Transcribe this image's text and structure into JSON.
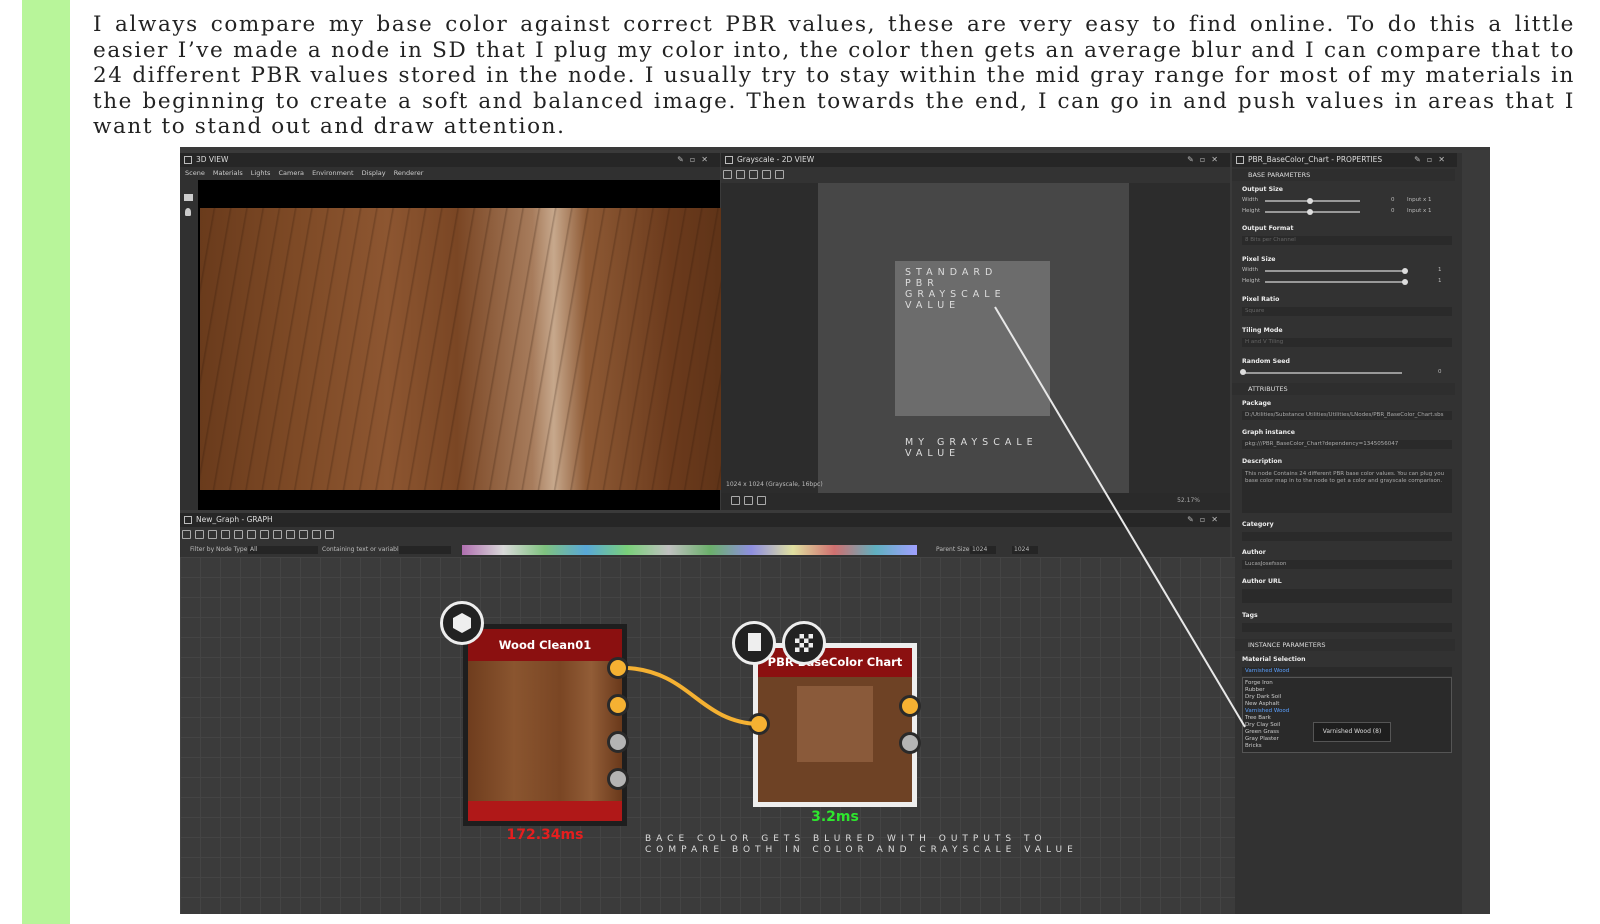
{
  "article": {
    "paragraph": "I always compare my base color against correct PBR values, these are very easy to find online. To do this a little easier I’ve made a node in SD that I plug my color into, the color then gets an average blur and I can compare that to 24 different PBR values stored in the node. I usually try to stay within the mid gray range for most of my materials in the beginning to create a soft and balanced image. Then towards the end, I can go in and push values in areas that I want to stand out and draw attention."
  },
  "view3d": {
    "title": "3D VIEW",
    "menu": [
      "Scene",
      "Materials",
      "Lights",
      "Camera",
      "Environment",
      "Display",
      "Renderer"
    ]
  },
  "view2d": {
    "title": "Grayscale - 2D VIEW",
    "annotation_top": "STANDARD PBR GRAYSCALE VALUE",
    "annotation_bottom": "MY GRAYSCALE VALUE",
    "image_info": "1024 x 1024 (Grayscale, 16bpc)",
    "zoom": "52.17%"
  },
  "graph": {
    "title": "New_Graph - GRAPH",
    "filter_label": "Filter by Node Type",
    "filter_value": "All",
    "containing_label": "Containing text or variable",
    "parent_size_label": "Parent Size:",
    "parent_size_w": "1024",
    "parent_size_h": "1024",
    "node1_title": "Wood Clean01",
    "node1_time": "172.34ms",
    "node2_title": "PBR BaseColor Chart",
    "node2_time": "3.2ms",
    "annotation": "BACE COLOR GETS BLURED WITH OUTPUTS TO COMPARE BOTH IN COLOR AND CRAYSCALE VALUE"
  },
  "properties": {
    "title": "PBR_BaseColor_Chart - PROPERTIES",
    "base_parameters": "BASE PARAMETERS",
    "output_size": "Output Size",
    "width": "Width",
    "height": "Height",
    "output_size_w": "0",
    "output_size_h": "0",
    "input_x1": "Input x 1",
    "output_format": "Output Format",
    "output_format_value": "8 Bits per Channel",
    "pixel_size": "Pixel Size",
    "pixel_w": "1",
    "pixel_h": "1",
    "pixel_ratio": "Pixel Ratio",
    "pixel_ratio_value": "Square",
    "tiling_mode": "Tiling Mode",
    "tiling_mode_value": "H and V Tiling",
    "random_seed": "Random Seed",
    "random_seed_value": "0",
    "attributes": "ATTRIBUTES",
    "package": "Package",
    "package_value": "D:/Utilities/Substance Utilities/Utilities/LNodes/PBR_BaseColor_Chart.sbs",
    "graph_instance": "Graph instance",
    "graph_instance_value": "pkg:///PBR_BaseColor_Chart?dependency=1345056047",
    "description": "Description",
    "description_value": "This node Contains 24 different PBR base color values. You can plug you base color map in to the node to get a color and grayscale comparison.",
    "category": "Category",
    "author": "Author",
    "author_value": "LucasJosefsson",
    "author_url": "Author URL",
    "tags": "Tags",
    "instance_parameters": "INSTANCE PARAMETERS",
    "material_selection": "Material Selection",
    "material_selected": "Varnished Wood",
    "material_options": [
      "Forge Iron",
      "Rubber",
      "Dry Dark Soil",
      "New Asphalt",
      "Varnished Wood",
      "Tree Bark",
      "Dry Clay Soil",
      "Green Grass",
      "Gray Plaster",
      "Bricks"
    ],
    "tooltip": "Varnished Wood (8)"
  }
}
